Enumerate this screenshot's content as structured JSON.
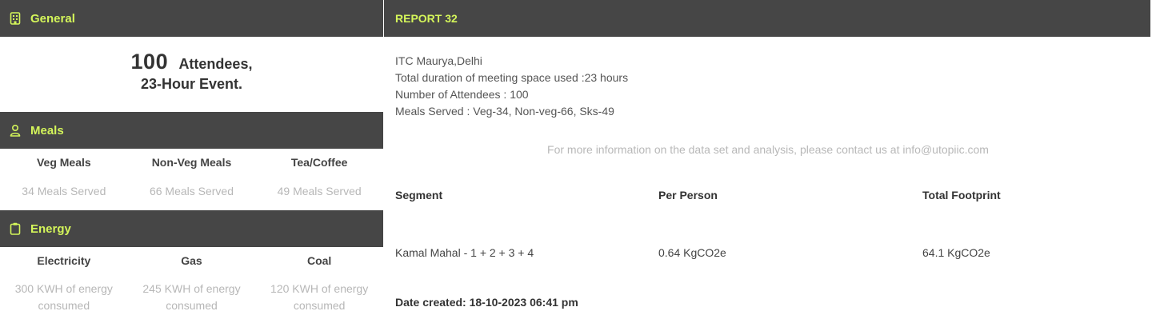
{
  "general": {
    "title": "General",
    "icon": "building-icon",
    "attendees_count": "100",
    "attendees_label": "Attendees,",
    "event_duration": "23-Hour Event."
  },
  "meals": {
    "title": "Meals",
    "icon": "person-icon",
    "columns": [
      {
        "label": "Veg Meals",
        "value": "34 Meals Served"
      },
      {
        "label": "Non-Veg Meals",
        "value": "66 Meals Served"
      },
      {
        "label": "Tea/Coffee",
        "value": "49 Meals Served"
      }
    ]
  },
  "energy": {
    "title": "Energy",
    "icon": "clipboard-icon",
    "columns": [
      {
        "label": "Electricity",
        "value": "300 KWH of energy consumed"
      },
      {
        "label": "Gas",
        "value": "245 KWH of energy consumed"
      },
      {
        "label": "Coal",
        "value": "120 KWH of energy consumed"
      }
    ]
  },
  "report": {
    "title": "REPORT 32",
    "venue": "ITC Maurya,Delhi",
    "duration": "Total duration of meeting space used :23 hours",
    "attendees": "Number of Attendees : 100",
    "meals_served": "Meals Served : Veg-34, Non-veg-66, Sks-49",
    "contact": "For more information on the data set and analysis, please contact us at info@utopiic.com",
    "table": {
      "headers": [
        "Segment",
        "Per Person",
        "Total Footprint"
      ],
      "rows": [
        [
          "Kamal Mahal - 1 + 2 + 3 + 4",
          "0.64 KgCO2e",
          "64.1 KgCO2e"
        ]
      ]
    },
    "date_created": "Date created: 18-10-2023 06:41 pm"
  },
  "colors": {
    "header_bg": "#464646",
    "accent": "#d4f55a",
    "muted_text": "#b7b7b7"
  }
}
